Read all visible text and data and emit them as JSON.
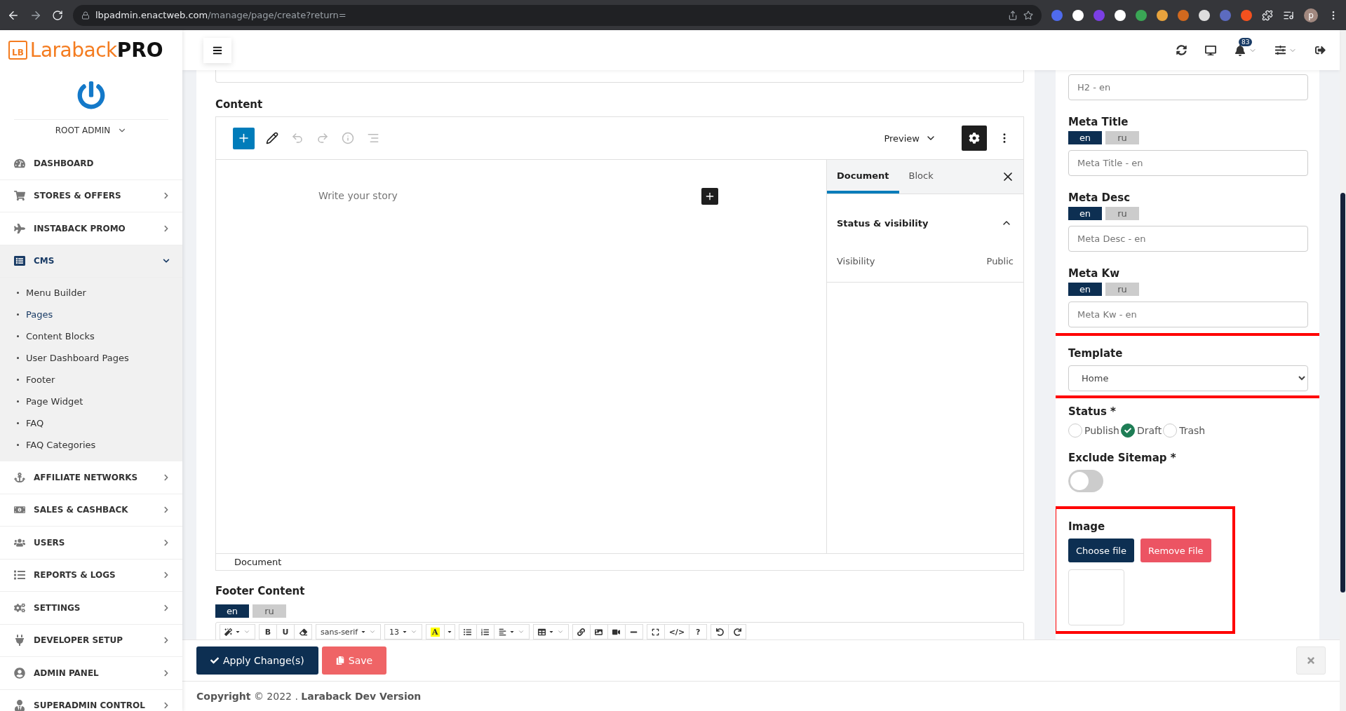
{
  "browser": {
    "url_host": "lbpadmin.enactweb.com",
    "url_path": "/manage/page/create?return=",
    "profile_initial": "p"
  },
  "brand": {
    "mark": "LB",
    "name": "Laraback",
    "suffix": "PRO"
  },
  "header": {
    "notification_count": "83"
  },
  "user": {
    "name": "ROOT ADMIN"
  },
  "sidebar": {
    "items": [
      {
        "label": "DASHBOARD",
        "expandable": false,
        "expanded": false,
        "selected": false
      },
      {
        "label": "STORES & OFFERS",
        "expandable": true,
        "expanded": false,
        "selected": false
      },
      {
        "label": "INSTABACK PROMO",
        "expandable": true,
        "expanded": false,
        "selected": false
      },
      {
        "label": "CMS",
        "expandable": true,
        "expanded": true,
        "selected": true,
        "children": [
          {
            "label": "Menu Builder",
            "selected": false
          },
          {
            "label": "Pages",
            "selected": true
          },
          {
            "label": "Content Blocks",
            "selected": false
          },
          {
            "label": "User Dashboard Pages",
            "selected": false
          },
          {
            "label": "Footer",
            "selected": false
          },
          {
            "label": "Page Widget",
            "selected": false
          },
          {
            "label": "FAQ",
            "selected": false
          },
          {
            "label": "FAQ Categories",
            "selected": false
          }
        ]
      },
      {
        "label": "AFFILIATE NETWORKS",
        "expandable": true,
        "expanded": false,
        "selected": false
      },
      {
        "label": "SALES & CASHBACK",
        "expandable": true,
        "expanded": false,
        "selected": false
      },
      {
        "label": "USERS",
        "expandable": true,
        "expanded": false,
        "selected": false
      },
      {
        "label": "REPORTS & LOGS",
        "expandable": true,
        "expanded": false,
        "selected": false
      },
      {
        "label": "SETTINGS",
        "expandable": true,
        "expanded": false,
        "selected": false
      },
      {
        "label": "DEVELOPER SETUP",
        "expandable": true,
        "expanded": false,
        "selected": false
      },
      {
        "label": "ADMIN PANEL",
        "expandable": true,
        "expanded": false,
        "selected": false
      },
      {
        "label": "SUPERADMIN CONTROL",
        "expandable": true,
        "expanded": false,
        "selected": false
      }
    ]
  },
  "editor": {
    "label": "Content",
    "preview": "Preview",
    "placeholder": "Write your story",
    "settings_on": true,
    "tabs": [
      {
        "label": "Document",
        "selected": true
      },
      {
        "label": "Block",
        "selected": false
      }
    ],
    "panel": {
      "title": "Status & visibility",
      "expanded": true,
      "rows": [
        {
          "label": "Visibility",
          "value": "Public"
        }
      ]
    },
    "breadcrumb": "Document"
  },
  "footer_content": {
    "label": "Footer Content",
    "languages": [
      {
        "label": "en",
        "selected": true
      },
      {
        "label": "ru",
        "selected": false
      }
    ],
    "toolbar": [
      {
        "buttons": [
          {
            "kind": "icon-dropdown"
          }
        ]
      },
      {
        "buttons": [
          {
            "kind": "text",
            "label": "B"
          },
          {
            "kind": "text",
            "label": "U"
          },
          {
            "kind": "icon"
          }
        ]
      },
      {
        "buttons": [
          {
            "kind": "select",
            "label": "sans-serif"
          }
        ]
      },
      {
        "buttons": [
          {
            "kind": "select",
            "label": "13"
          }
        ]
      },
      {
        "buttons": [
          {
            "kind": "color",
            "label": "A"
          },
          {
            "kind": "caret"
          }
        ]
      },
      {
        "buttons": [
          {
            "kind": "icon"
          },
          {
            "kind": "icon"
          },
          {
            "kind": "icon-dropdown"
          }
        ]
      },
      {
        "buttons": [
          {
            "kind": "icon-dropdown"
          }
        ]
      },
      {
        "buttons": [
          {
            "kind": "icon"
          },
          {
            "kind": "icon"
          },
          {
            "kind": "icon"
          },
          {
            "kind": "icon"
          }
        ]
      },
      {
        "buttons": [
          {
            "kind": "icon"
          },
          {
            "kind": "text",
            "label": "</>"
          },
          {
            "kind": "text",
            "label": "?"
          }
        ]
      },
      {
        "buttons": [
          {
            "kind": "icon"
          },
          {
            "kind": "icon"
          }
        ]
      }
    ]
  },
  "meta_fields": [
    {
      "placeholder": "H2 - en"
    },
    {
      "label": "Meta Title",
      "languages": [
        {
          "label": "en",
          "selected": true
        },
        {
          "label": "ru",
          "selected": false
        }
      ],
      "placeholder": "Meta Title - en"
    },
    {
      "label": "Meta Desc",
      "languages": [
        {
          "label": "en",
          "selected": true
        },
        {
          "label": "ru",
          "selected": false
        }
      ],
      "placeholder": "Meta Desc - en"
    },
    {
      "label": "Meta Kw",
      "languages": [
        {
          "label": "en",
          "selected": true
        },
        {
          "label": "ru",
          "selected": false
        }
      ],
      "placeholder": "Meta Kw - en"
    }
  ],
  "template": {
    "label": "Template",
    "value": "Home",
    "highlighted": true
  },
  "status": {
    "label": "Status *",
    "options": [
      {
        "label": "Publish",
        "selected": false
      },
      {
        "label": "Draft",
        "selected": true
      },
      {
        "label": "Trash",
        "selected": false
      }
    ]
  },
  "exclude_sitemap": {
    "label": "Exclude Sitemap *",
    "on": false
  },
  "image": {
    "label": "Image",
    "highlighted": true,
    "buttons": [
      {
        "label": "Choose file",
        "kind": "primary"
      },
      {
        "label": "Remove File",
        "kind": "danger"
      }
    ]
  },
  "actions": [
    {
      "label": "Apply Change(s)",
      "kind": "primary"
    },
    {
      "label": "Save",
      "kind": "danger"
    }
  ],
  "footer": {
    "text": "**Copyright** © 2022 . **Laraback Dev Version**"
  }
}
